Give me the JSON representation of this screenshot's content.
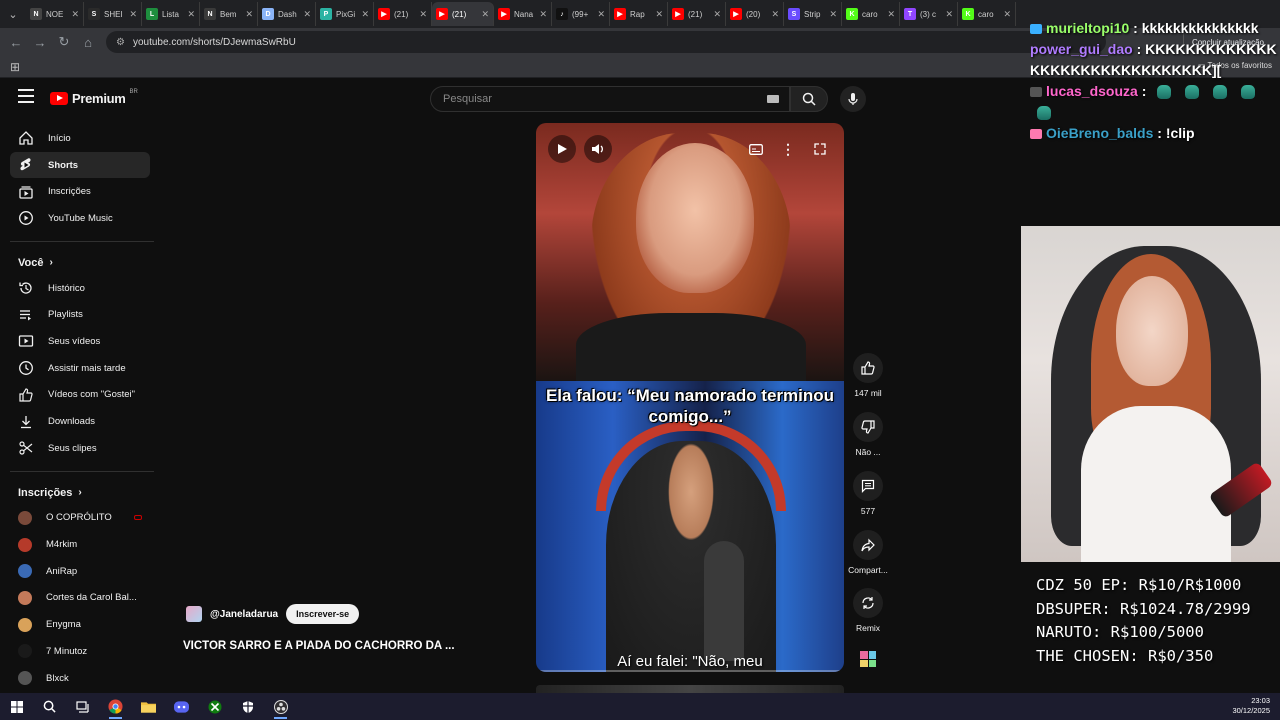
{
  "browser": {
    "tabs": [
      {
        "label": "NOE",
        "favicon": "N",
        "color": "#444444",
        "active": false
      },
      {
        "label": "SHEI",
        "favicon": "S",
        "color": "#2a2a2a",
        "active": false
      },
      {
        "label": "Lista",
        "favicon": "L",
        "color": "#1e8e3e",
        "active": false
      },
      {
        "label": "Bem",
        "favicon": "N",
        "color": "#3a3a3a",
        "active": false
      },
      {
        "label": "Dash",
        "favicon": "D",
        "color": "#8ab4f8",
        "active": false
      },
      {
        "label": "PixGi",
        "favicon": "P",
        "color": "#2bb3a3",
        "active": false
      },
      {
        "label": "(21)",
        "favicon": "▶",
        "color": "#ff0000",
        "active": false
      },
      {
        "label": "(21)",
        "favicon": "▶",
        "color": "#ff0000",
        "active": true
      },
      {
        "label": "Nana",
        "favicon": "▶",
        "color": "#ff0000",
        "active": false
      },
      {
        "label": "(99+",
        "favicon": "♪",
        "color": "#111111",
        "active": false
      },
      {
        "label": "Rap",
        "favicon": "▶",
        "color": "#ff0000",
        "active": false
      },
      {
        "label": "(21)",
        "favicon": "▶",
        "color": "#ff0000",
        "active": false
      },
      {
        "label": "(20)",
        "favicon": "▶",
        "color": "#ff0000",
        "active": false
      },
      {
        "label": "Strip",
        "favicon": "S",
        "color": "#6a4cff",
        "active": false
      },
      {
        "label": "caro",
        "favicon": "K",
        "color": "#53fc18",
        "active": false
      },
      {
        "label": "(3) c",
        "favicon": "T",
        "color": "#9146ff",
        "active": false
      },
      {
        "label": "caro",
        "favicon": "K",
        "color": "#53fc18",
        "active": false
      }
    ],
    "url": "youtube.com/shorts/DJewmaSwRbU",
    "finish_update_label": "Concluir atualização",
    "bookmarks_all": "Todos os favoritos"
  },
  "youtube": {
    "brand": "Premium",
    "region": "BR",
    "search_placeholder": "Pesquisar",
    "sidebar": {
      "main": [
        {
          "label": "Início",
          "icon": "home-icon"
        },
        {
          "label": "Shorts",
          "icon": "shorts-icon",
          "active": true
        },
        {
          "label": "Inscrições",
          "icon": "subscriptions-icon"
        },
        {
          "label": "YouTube Music",
          "icon": "music-icon"
        }
      ],
      "you_header": "Você",
      "you": [
        {
          "label": "Histórico",
          "icon": "history-icon"
        },
        {
          "label": "Playlists",
          "icon": "playlists-icon"
        },
        {
          "label": "Seus vídeos",
          "icon": "your-videos-icon"
        },
        {
          "label": "Assistir mais tarde",
          "icon": "watch-later-icon"
        },
        {
          "label": "Vídeos com \"Gostei\"",
          "icon": "liked-icon"
        },
        {
          "label": "Downloads",
          "icon": "download-icon"
        },
        {
          "label": "Seus clipes",
          "icon": "clips-icon"
        }
      ],
      "subs_header": "Inscrições",
      "subs": [
        {
          "label": "O COPRÓLITO",
          "color": "#7a4a3a",
          "live": true
        },
        {
          "label": "M4rkim",
          "color": "#b53a2a",
          "live": false
        },
        {
          "label": "AniRap",
          "color": "#3a6ab5",
          "live": false
        },
        {
          "label": "Cortes da Carol Bal...",
          "color": "#c47a5a",
          "live": false
        },
        {
          "label": "Enygma",
          "color": "#d9a25a",
          "live": false
        },
        {
          "label": "7 Minutoz",
          "color": "#1a1a1a",
          "live": false
        },
        {
          "label": "Blxck",
          "color": "#555555",
          "live": false
        }
      ]
    },
    "short": {
      "caption": "Ela falou: “Meu namorado terminou comigo...”",
      "subtitle": "Aí eu falei: \"Não, meu",
      "likes": "147 mil",
      "dislike_label": "Não ...",
      "comments": "577",
      "share_label": "Compart...",
      "remix_label": "Remix",
      "channel": "@Janeladarua",
      "subscribe_label": "Inscrever-se",
      "title": "VICTOR SARRO E A PIADA DO CACHORRO DA ..."
    }
  },
  "stream_overlay": {
    "chat": [
      {
        "user": "murieltopi10",
        "color": "#9aff6a",
        "message": "kkkkkkkkkkkkkkk",
        "badge": "#3ab0ff",
        "emotes": 0
      },
      {
        "user": "power_gui_dao",
        "color": "#b07cff",
        "message": "KKKKKKKKKKKKKKKKKKKKKKKKKKKKKKK][",
        "badge": "",
        "emotes": 0
      },
      {
        "user": "lucas_dsouza",
        "color": "#ff66cc",
        "message": "",
        "badge": "#555555",
        "emotes": 5
      },
      {
        "user": "OieBreno_balds",
        "color": "#3aa0c8",
        "message": "!clip",
        "badge": "#ff7ab0",
        "emotes": 0
      }
    ],
    "goals": [
      "CDZ 50 EP: R$10/R$1000",
      "DBSUPER: R$1024.78/2999",
      "NARUTO: R$100/5000",
      "THE CHOSEN: R$0/350"
    ]
  },
  "taskbar": {
    "apps": [
      "windows-start-icon",
      "search-icon",
      "task-view-icon",
      "chrome-icon",
      "file-explorer-icon",
      "discord-icon",
      "xbox-icon",
      "shield-app-icon",
      "obs-icon"
    ],
    "time": "23:03",
    "date": "30/12/2025"
  }
}
